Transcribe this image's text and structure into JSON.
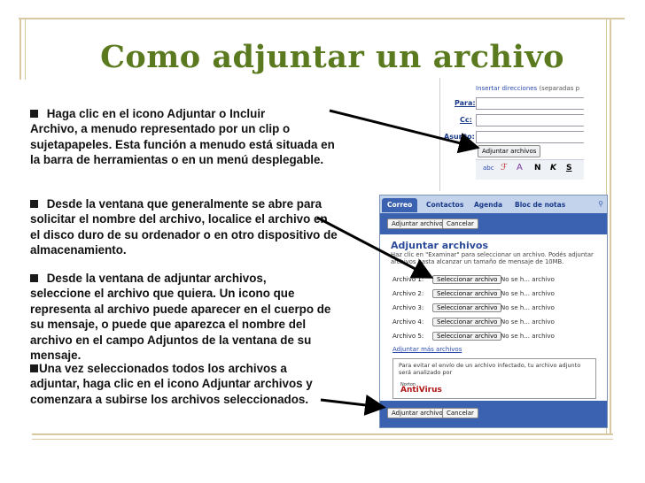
{
  "slide": {
    "title": "Como adjuntar un archivo",
    "bullets": [
      {
        "prefix": " Haga clic en el icono Adjuntar o Incluir",
        "rest": "Archivo, a menudo representado por un clip o sujetapapeles. Esta función a menudo está situada en la barra de herramientas o en un menú desplegable."
      },
      {
        "prefix": " Desde la ventana que generalmente se abre para",
        "rest": "solicitar el nombre del archivo, localice el archivo en el disco duro de su ordenador o en otro dispositivo de almacenamiento."
      },
      {
        "prefix": " Desde la ventana de adjuntar archivos,",
        "rest": "seleccione el archivo que quiera. Un icono que representa al archivo puede aparecer en el cuerpo de su mensaje, o puede que aparezca el nombre del archivo en el campo Adjuntos de la ventana de su mensaje."
      },
      {
        "prefix": "Una vez seleccionados todos los archivos a",
        "rest": "adjuntar, haga clic en el icono Adjuntar archivos y comenzara a subirse los archivos seleccionados."
      }
    ]
  },
  "compose": {
    "insert_label": "Insertar direcciones",
    "insert_note": "(separadas p",
    "to": "Para:",
    "cc": "Cc:",
    "subject": "Asunto:",
    "attach_button": "Adjuntar archivos",
    "toolbar_icons": [
      "abc",
      "ℱ",
      "A",
      "N",
      "K",
      "S"
    ]
  },
  "attach_window": {
    "tabs": [
      "Correo",
      "Contactos",
      "Agenda",
      "Bloc de notas"
    ],
    "top_buttons": [
      "Adjuntar archivos",
      "Cancelar"
    ],
    "heading": "Adjuntar archivos",
    "description": "Haz clic en \"Examinar\" para seleccionar un archivo. Podés adjuntar archivos hasta alcanzar un tamaño de mensaje de 10MB.",
    "rows": [
      {
        "label": "Archivo 1:",
        "button": "Seleccionar archivo",
        "file": "No se h... archivo"
      },
      {
        "label": "Archivo 2:",
        "button": "Seleccionar archivo",
        "file": "No se h... archivo"
      },
      {
        "label": "Archivo 3:",
        "button": "Seleccionar archivo",
        "file": "No se h... archivo"
      },
      {
        "label": "Archivo 4:",
        "button": "Seleccionar archivo",
        "file": "No se h... archivo"
      },
      {
        "label": "Archivo 5:",
        "button": "Seleccionar archivo",
        "file": "No se h... archivo"
      }
    ],
    "more_link": "Adjuntar más archivos",
    "av_text": "Para evitar el envío de un archivo infectado, tu archivo adjunto será analizado por",
    "av_brand_small": "Norton",
    "av_brand": "AntiVirus",
    "bottom_buttons": [
      "Adjuntar archivos",
      "Cancelar"
    ]
  }
}
